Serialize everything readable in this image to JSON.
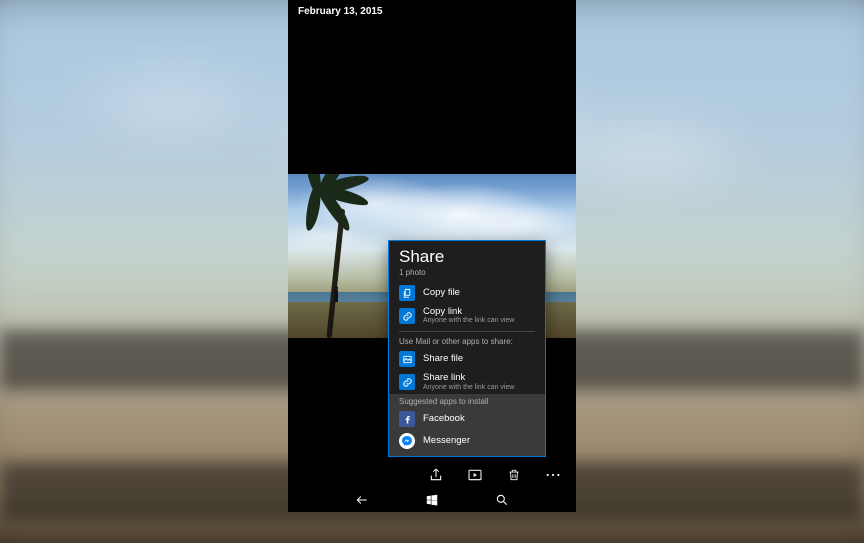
{
  "topbar": {
    "date": "February 13, 2015"
  },
  "share": {
    "title": "Share",
    "subtitle": "1 photo",
    "copy": [
      {
        "icon": "copy-file",
        "label": "Copy file"
      },
      {
        "icon": "copy-link",
        "label": "Copy link",
        "desc": "Anyone with the link can view"
      }
    ],
    "apps_header": "Use Mail or other apps to share:",
    "apps": [
      {
        "icon": "share-file",
        "label": "Share file"
      },
      {
        "icon": "share-link",
        "label": "Share link",
        "desc": "Anyone with the link can view"
      }
    ],
    "suggested_header": "Suggested apps to install",
    "suggested": [
      {
        "icon": "facebook",
        "label": "Facebook"
      },
      {
        "icon": "messenger",
        "label": "Messenger"
      }
    ]
  },
  "appbar": {
    "share": "Share",
    "slideshow": "Slideshow",
    "delete": "Delete",
    "more": "More"
  },
  "nav": {
    "back": "Back",
    "start": "Start",
    "search": "Search"
  }
}
